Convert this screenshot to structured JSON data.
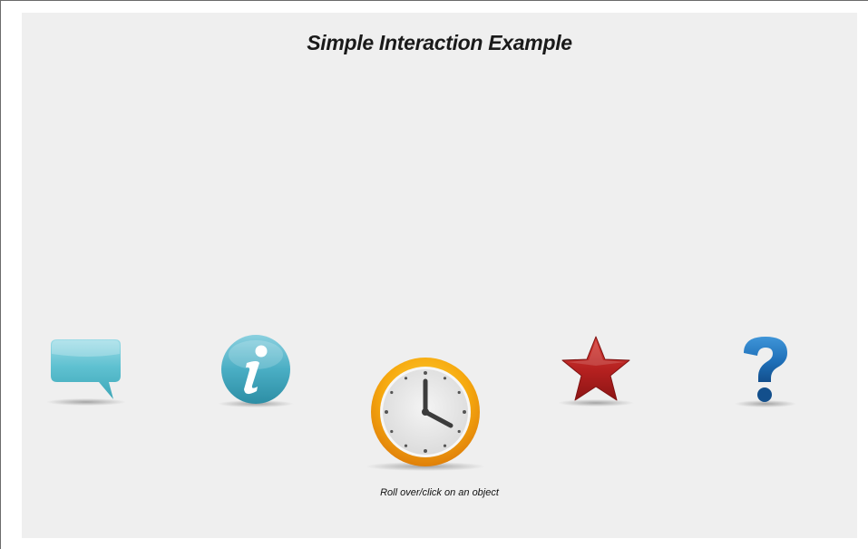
{
  "title": "Simple Interaction Example",
  "caption": "Roll over/click on an object",
  "icons": [
    {
      "name": "speech-bubble-icon",
      "color": "#5bbfcf"
    },
    {
      "name": "info-icon",
      "color": "#4aaec4"
    },
    {
      "name": "clock-icon",
      "color": "#f2a516"
    },
    {
      "name": "star-icon",
      "color": "#b3201f"
    },
    {
      "name": "question-mark-icon",
      "color": "#1e6fb8"
    }
  ]
}
